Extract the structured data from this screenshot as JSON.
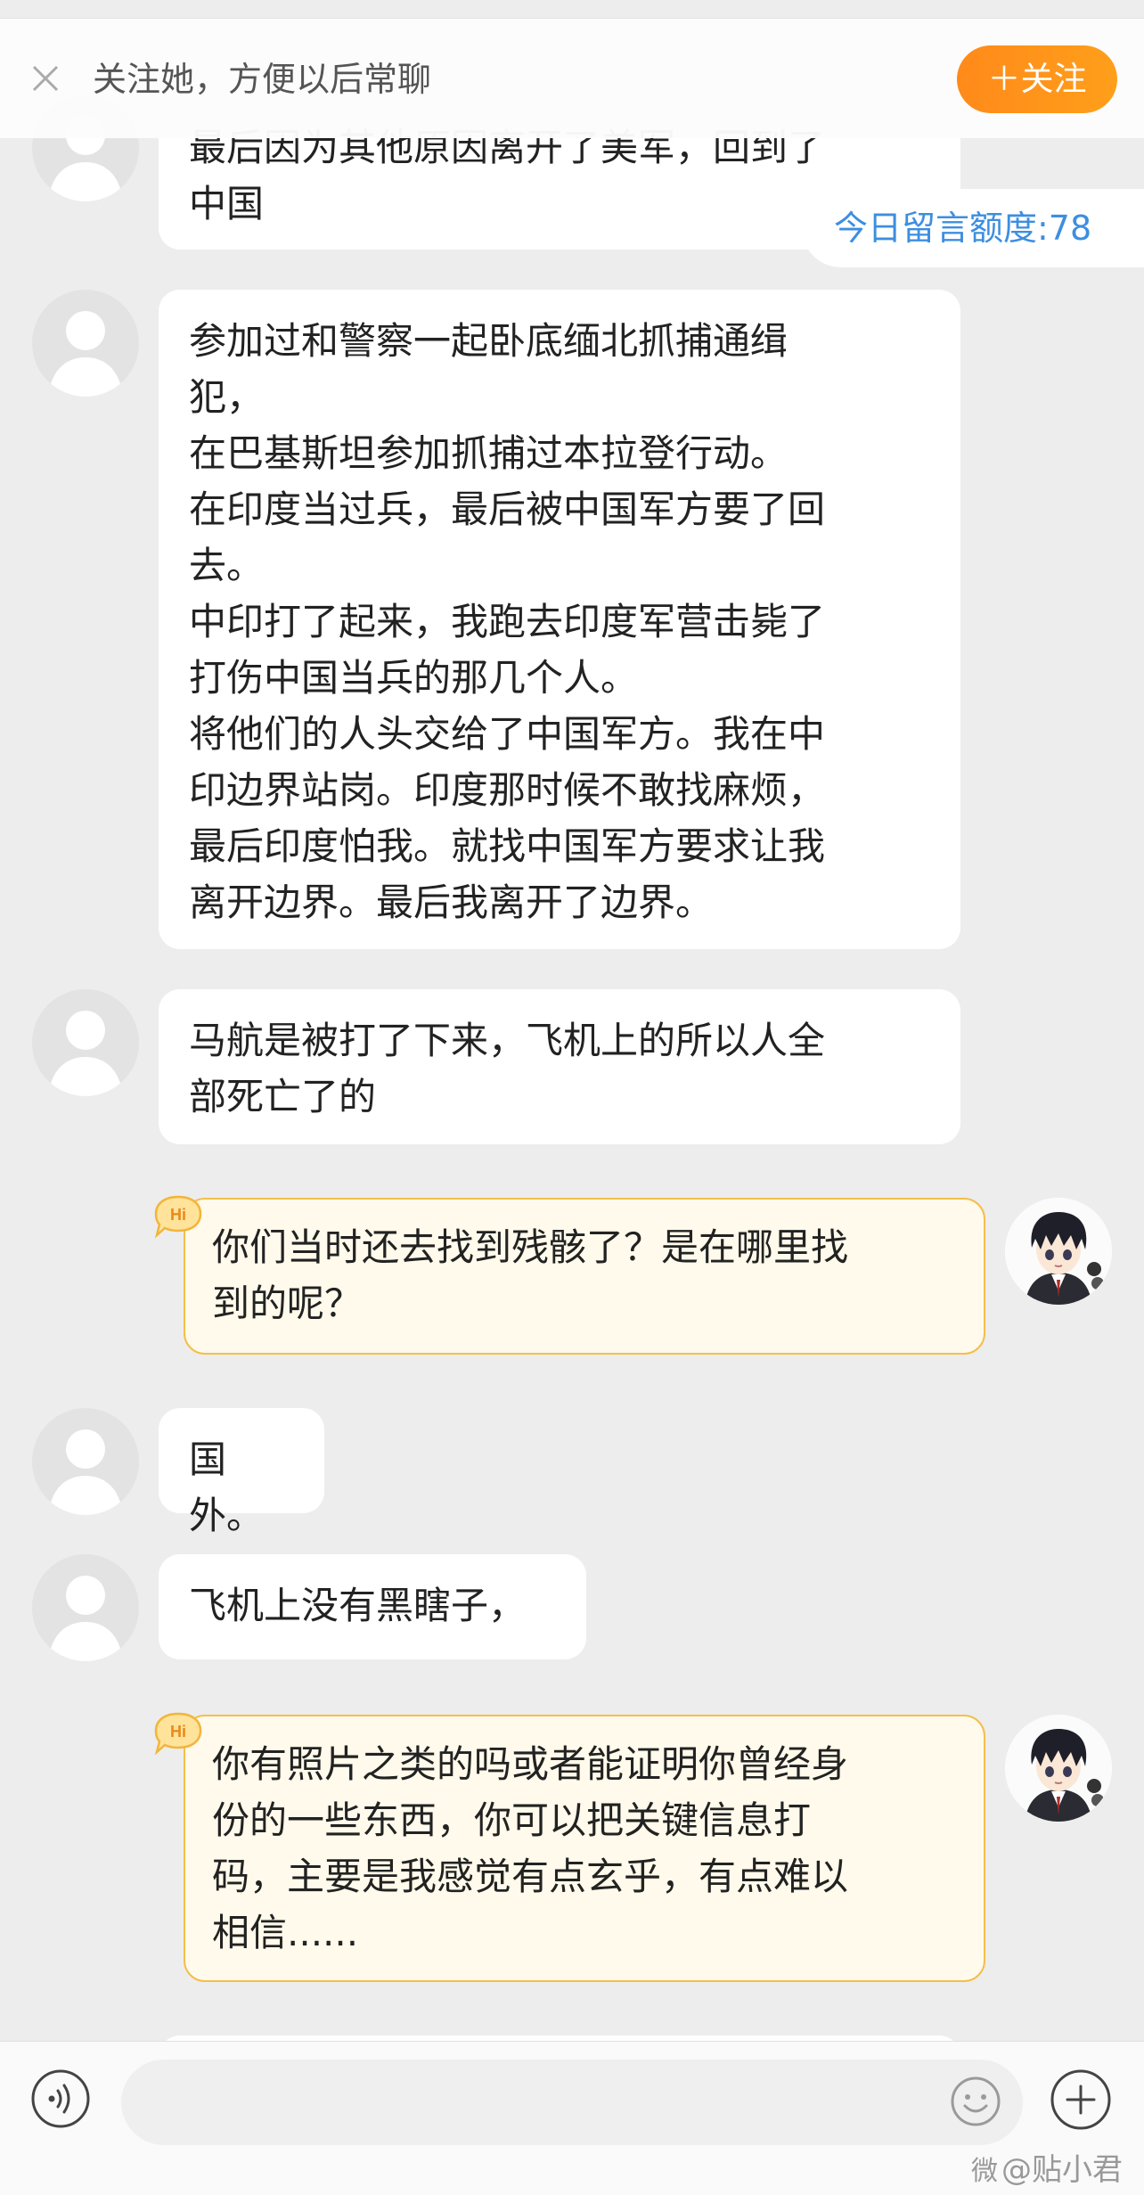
{
  "top_bar": {
    "tip": "关注她，方便以后常聊",
    "follow_button": "＋关注"
  },
  "quota": "今日留言额度:78",
  "messages": [
    {
      "side": "in",
      "text": "最后因为其他原因离开了美军，回到了\n中国"
    },
    {
      "side": "in",
      "text": "参加过和警察一起卧底缅北抓捕通缉\n犯，\n在巴基斯坦参加抓捕过本拉登行动。\n在印度当过兵，最后被中国军方要了回\n去。\n中印打了起来，我跑去印度军营击毙了\n打伤中国当兵的那几个人。\n将他们的人头交给了中国军方。我在中\n印边界站岗。印度那时候不敢找麻烦，\n最后印度怕我。就找中国军方要求让我\n离开边界。最后我离开了边界。"
    },
    {
      "side": "in",
      "text": "马航是被打了下来，飞机上的所以人全\n部死亡了的"
    },
    {
      "side": "out",
      "badge": "Hi",
      "text": "你们当时还去找到残骸了？是在哪里找\n到的呢？"
    },
    {
      "side": "in",
      "text": "国外。"
    },
    {
      "side": "in",
      "text": "飞机上没有黑瞎子，"
    },
    {
      "side": "out",
      "badge": "Hi",
      "text": "你有照片之类的吗或者能证明你曾经身\n份的一些东西，你可以把关键信息打\n码，主要是我感觉有点玄乎，有点难以\n相信......"
    }
  ],
  "input": {
    "placeholder": ""
  },
  "watermark": {
    "mark": "微",
    "text": "@贴小君"
  },
  "colors": {
    "accent_orange": "#ff8f1a",
    "quota_blue": "#3d8ee0",
    "outgoing_bubble": "#fffaeb",
    "outgoing_border": "#f3bf4a"
  }
}
